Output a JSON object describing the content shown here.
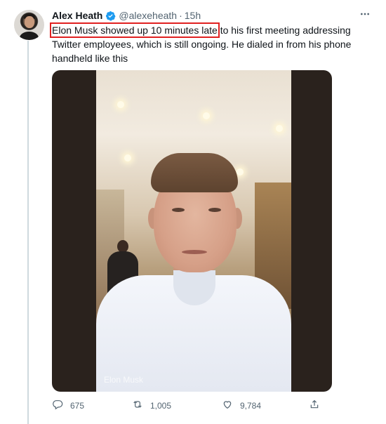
{
  "tweet": {
    "author_name": "Alex Heath",
    "handle": "@alexeheath",
    "separator": "·",
    "time": "15h",
    "text_highlighted": "Elon Musk showed up 10 minutes late",
    "text_rest": " to his first meeting addressing Twitter employees, which is still ongoing. He dialed in from his phone handheld like this"
  },
  "media": {
    "watermark": "Elon Musk"
  },
  "actions": {
    "replies": "675",
    "retweets": "1,005",
    "likes": "9,784"
  },
  "icons": {
    "verified": "verified-badge-icon",
    "more": "more-dots-icon",
    "reply": "reply-icon",
    "retweet": "retweet-icon",
    "like": "heart-icon",
    "share": "share-icon"
  },
  "colors": {
    "verified": "#1d9bf0",
    "highlight_box": "#e02020",
    "secondary_text": "#536471"
  }
}
